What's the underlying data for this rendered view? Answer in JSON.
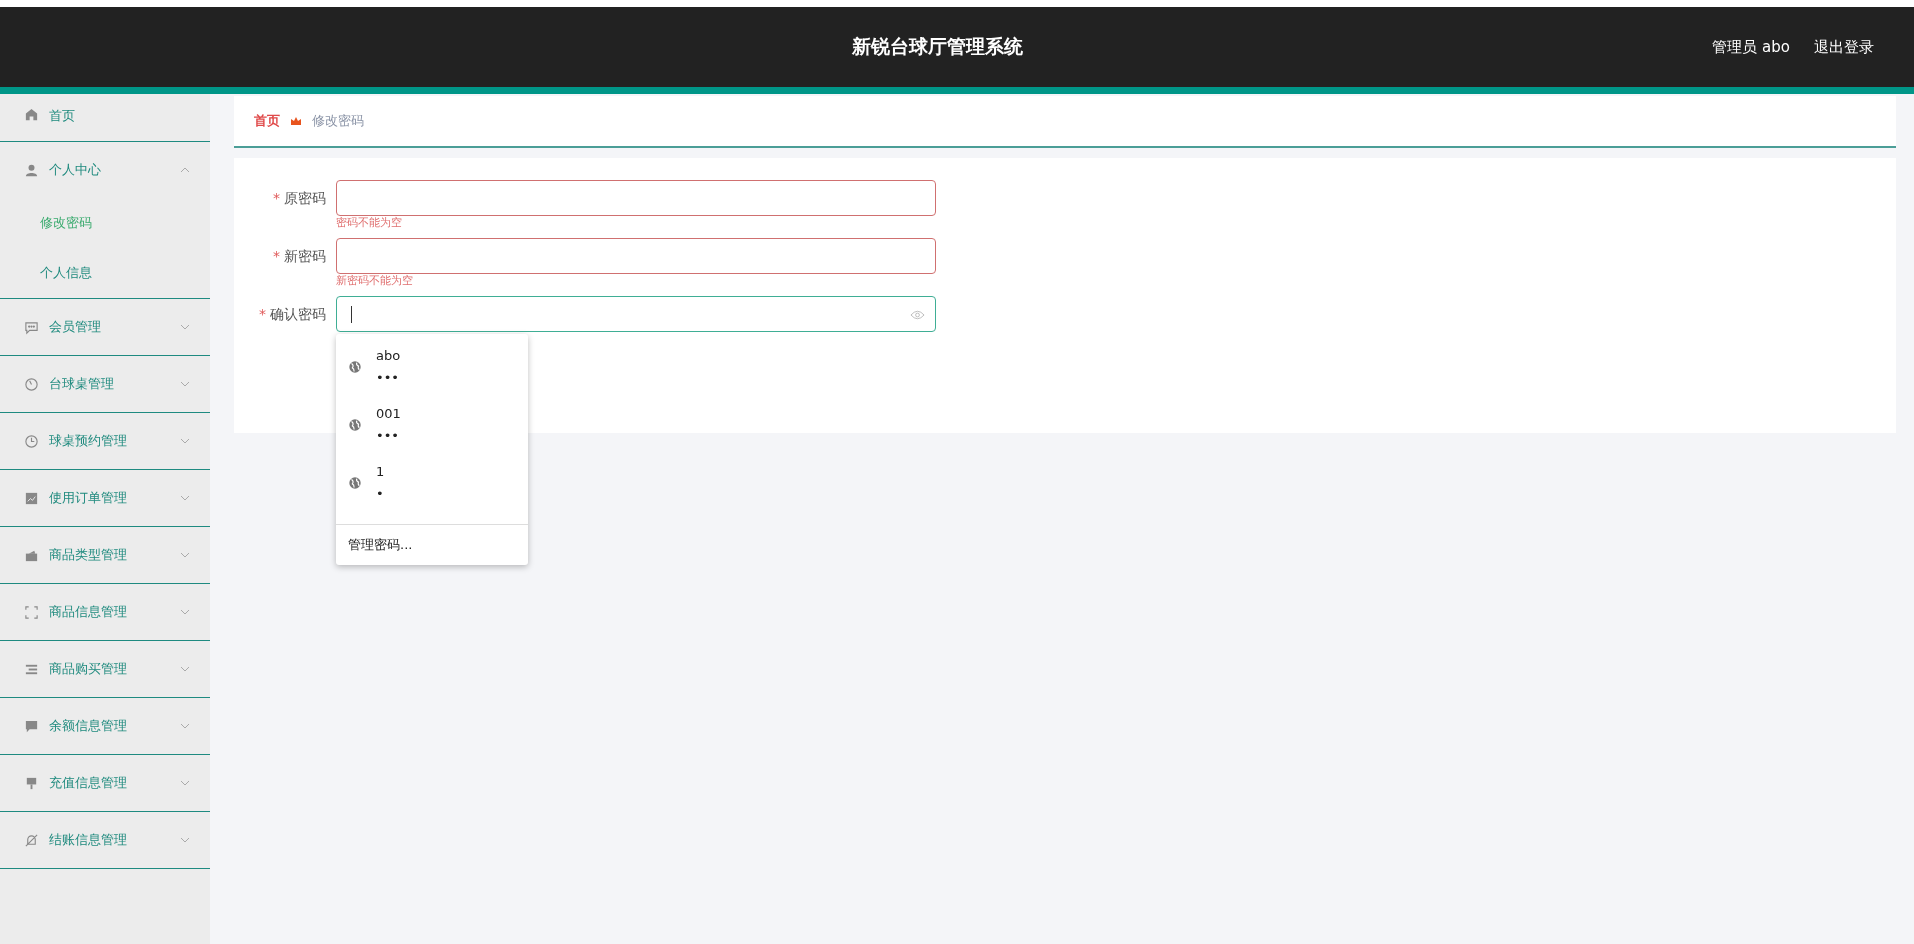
{
  "header": {
    "title": "新锐台球厅管理系统",
    "user": "管理员 abo",
    "logout": "退出登录"
  },
  "sidebar": {
    "items": [
      {
        "label": "首页",
        "kind": "link",
        "selected": false
      },
      {
        "label": "个人中心",
        "kind": "group",
        "expanded": true,
        "children": [
          {
            "label": "修改密码",
            "selected": true
          },
          {
            "label": "个人信息",
            "selected": false
          }
        ]
      },
      {
        "label": "会员管理",
        "kind": "group",
        "expanded": false
      },
      {
        "label": "台球桌管理",
        "kind": "group",
        "expanded": false
      },
      {
        "label": "球桌预约管理",
        "kind": "group",
        "expanded": false
      },
      {
        "label": "使用订单管理",
        "kind": "group",
        "expanded": false
      },
      {
        "label": "商品类型管理",
        "kind": "group",
        "expanded": false
      },
      {
        "label": "商品信息管理",
        "kind": "group",
        "expanded": false
      },
      {
        "label": "商品购买管理",
        "kind": "group",
        "expanded": false
      },
      {
        "label": "余额信息管理",
        "kind": "group",
        "expanded": false
      },
      {
        "label": "充值信息管理",
        "kind": "group",
        "expanded": false
      },
      {
        "label": "结账信息管理",
        "kind": "group",
        "expanded": false
      }
    ]
  },
  "breadcrumb": [
    "首页",
    "修改密码"
  ],
  "form": {
    "fields": [
      {
        "label": "原密码",
        "required_mark": "*",
        "focused": false,
        "error": "密码不能为空"
      },
      {
        "label": "新密码",
        "required_mark": "*",
        "focused": false,
        "error": "新密码不能为空"
      },
      {
        "label": "确认密码",
        "required_mark": "*",
        "focused": true
      }
    ]
  },
  "autofill": {
    "entries": [
      {
        "username": "abo",
        "password": "•••"
      },
      {
        "username": "001",
        "password": "•••"
      },
      {
        "username": "1",
        "password": "•"
      }
    ],
    "manage": "管理密码..."
  }
}
